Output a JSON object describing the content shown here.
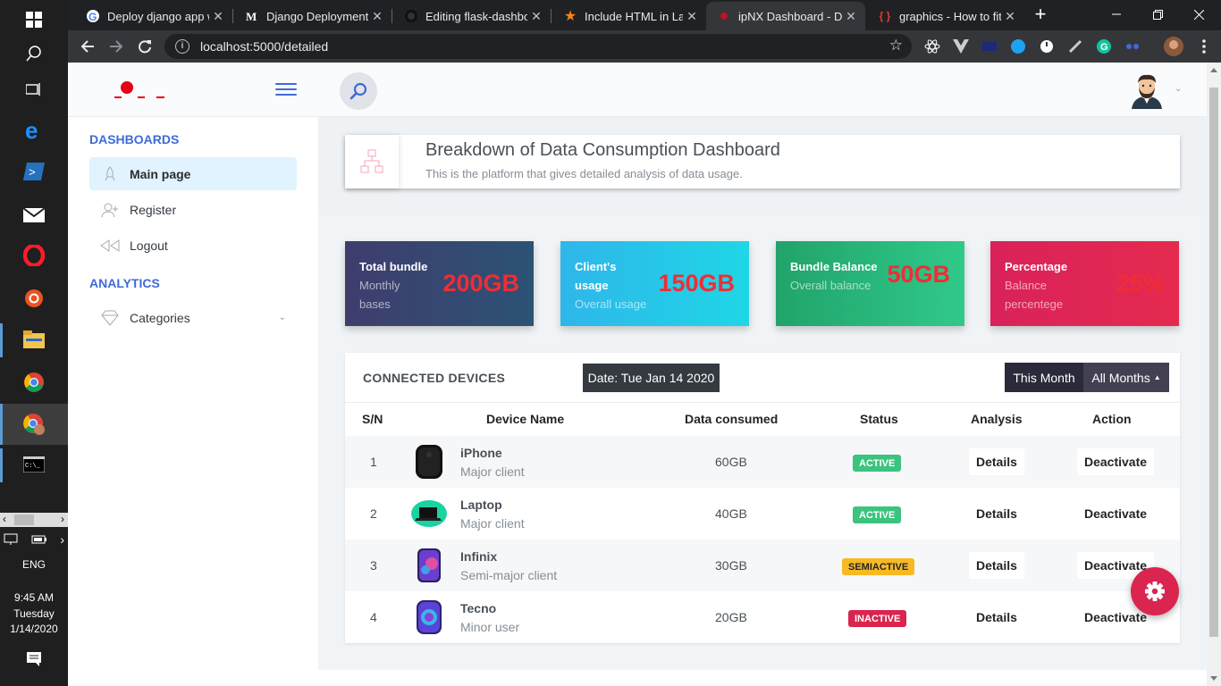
{
  "taskbar": {
    "time": "9:45 AM",
    "day": "Tuesday",
    "date": "1/14/2020",
    "language": "ENG",
    "icons": [
      "windows-start-icon",
      "search-icon",
      "task-view-icon",
      "edge-icon",
      "powershell-icon",
      "mail-icon",
      "opera-icon",
      "ubuntu-icon",
      "file-explorer-icon",
      "chrome-icon",
      "chrome-profile-icon",
      "terminal-icon"
    ]
  },
  "browser": {
    "tabs": [
      {
        "title": "Deploy django app w",
        "icon": "google-icon"
      },
      {
        "title": "Django Deployment (",
        "icon": "medium-icon"
      },
      {
        "title": "Editing flask-dashbo",
        "icon": "github-icon"
      },
      {
        "title": "Include HTML in LaTe",
        "icon": "star-icon"
      },
      {
        "title": "ipNX Dashboard - Da",
        "icon": "ipnx-icon"
      },
      {
        "title": "graphics - How to fit",
        "icon": "braces-icon"
      }
    ],
    "active_tab": 4,
    "url": "localhost:5000/detailed"
  },
  "app": {
    "sidebar": {
      "section_dashboards": "DASHBOARDS",
      "section_analytics": "ANALYTICS",
      "items": [
        {
          "label": "Main page",
          "icon": "rocket-icon"
        },
        {
          "label": "Register",
          "icon": "add-user-icon"
        },
        {
          "label": "Logout",
          "icon": "back-icon"
        },
        {
          "label": "Categories",
          "icon": "diamond-icon"
        }
      ]
    },
    "page_title": "Breakdown of Data Consumption Dashboard",
    "page_subtitle": "This is the platform that gives detailed analysis of data usage.",
    "stats": [
      {
        "heading": "Total bundle",
        "sub1": "Monthly",
        "sub2": "bases",
        "value": "200GB",
        "color": "#3a4a7a"
      },
      {
        "heading": "Client's",
        "sub1": "usage",
        "sub2": "Overall usage",
        "value": "150GB",
        "color": "#21c4e8"
      },
      {
        "heading": "Bundle Balance",
        "sub1": "Overall balance",
        "sub2": "",
        "value": "50GB",
        "color": "#2bb573"
      },
      {
        "heading": "Percentage",
        "sub1": "Balance",
        "sub2": "percentege",
        "value": "25%",
        "color": "#e4245a"
      }
    ],
    "devices_panel": {
      "title": "CONNECTED DEVICES",
      "date": "Date: Tue Jan 14 2020",
      "this_month": "This Month",
      "all_months": "All Months",
      "columns": [
        "S/N",
        "Device Name",
        "Data consumed",
        "Status",
        "Analysis",
        "Action"
      ],
      "rows": [
        {
          "sn": "1",
          "name": "iPhone",
          "sub": "Major client",
          "data": "60GB",
          "status": "ACTIVE",
          "status_color": "#3ac47d",
          "analysis": "Details",
          "action": "Deactivate"
        },
        {
          "sn": "2",
          "name": "Laptop",
          "sub": "Major client",
          "data": "40GB",
          "status": "ACTIVE",
          "status_color": "#3ac47d",
          "analysis": "Details",
          "action": "Deactivate"
        },
        {
          "sn": "3",
          "name": "Infinix",
          "sub": "Semi-major client",
          "data": "30GB",
          "status": "SEMIACTIVE",
          "status_color": "#f7b924",
          "analysis": "Details",
          "action": "Deactivate"
        },
        {
          "sn": "4",
          "name": "Tecno",
          "sub": "Minor user",
          "data": "20GB",
          "status": "INACTIVE",
          "status_color": "#d92550",
          "analysis": "Details",
          "action": "Deactivate"
        }
      ]
    }
  }
}
